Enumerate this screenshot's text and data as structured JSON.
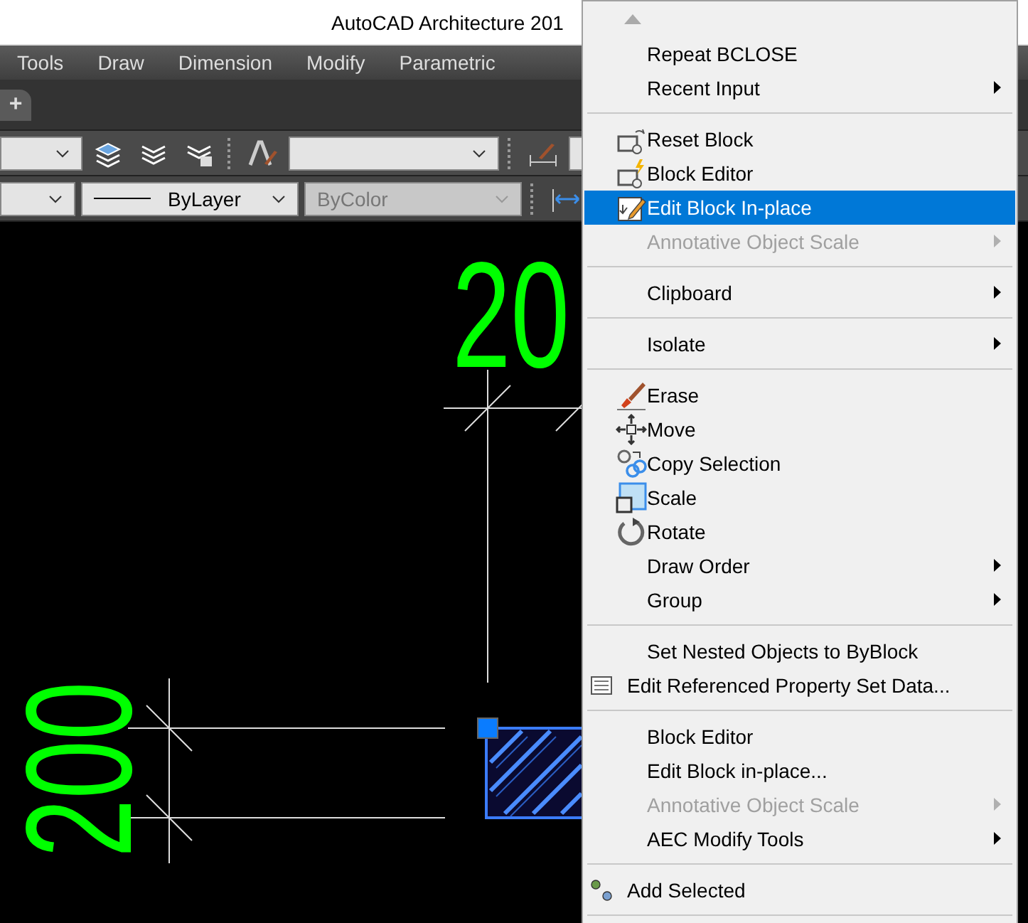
{
  "title_bar": {
    "title": "AutoCAD Architecture 201"
  },
  "menu_bar": [
    "Tools",
    "Draw",
    "Dimension",
    "Modify",
    "Parametric"
  ],
  "file_tabs": {
    "new_tab": "+"
  },
  "properties_toolbar": {
    "linetype": {
      "value": "ByLayer",
      "disabled": false
    },
    "plot_style": {
      "value": "ByColor",
      "disabled": true
    }
  },
  "drawing": {
    "top_dimension": "20",
    "left_dimension": "200"
  },
  "context_menu": {
    "items": [
      {
        "kind": "scroll-up"
      },
      {
        "kind": "plain",
        "label": "Repeat BCLOSE",
        "disabled": false,
        "selected": false,
        "submenu": false
      },
      {
        "kind": "plain",
        "label": "Recent Input",
        "disabled": false,
        "selected": false,
        "submenu": true
      },
      {
        "kind": "separator"
      },
      {
        "kind": "icon",
        "label": "Reset Block",
        "disabled": false,
        "selected": false,
        "submenu": false
      },
      {
        "kind": "icon",
        "label": "Block Editor",
        "disabled": false,
        "selected": false,
        "submenu": false
      },
      {
        "kind": "icon",
        "label": "Edit Block In-place",
        "disabled": false,
        "selected": true,
        "submenu": false
      },
      {
        "kind": "plain",
        "label": "Annotative Object Scale",
        "disabled": true,
        "selected": false,
        "submenu": true
      },
      {
        "kind": "separator"
      },
      {
        "kind": "plain",
        "label": "Clipboard",
        "disabled": false,
        "selected": false,
        "submenu": true
      },
      {
        "kind": "separator"
      },
      {
        "kind": "plain",
        "label": "Isolate",
        "disabled": false,
        "selected": false,
        "submenu": true
      },
      {
        "kind": "separator"
      },
      {
        "kind": "icon",
        "label": "Erase",
        "disabled": false,
        "selected": false,
        "submenu": false
      },
      {
        "kind": "icon",
        "label": "Move",
        "disabled": false,
        "selected": false,
        "submenu": false
      },
      {
        "kind": "icon",
        "label": "Copy Selection",
        "disabled": false,
        "selected": false,
        "submenu": false
      },
      {
        "kind": "icon",
        "label": "Scale",
        "disabled": false,
        "selected": false,
        "submenu": false
      },
      {
        "kind": "icon",
        "label": "Rotate",
        "disabled": false,
        "selected": false,
        "submenu": false
      },
      {
        "kind": "plain",
        "label": "Draw Order",
        "disabled": false,
        "selected": false,
        "submenu": true
      },
      {
        "kind": "plain",
        "label": "Group",
        "disabled": false,
        "selected": false,
        "submenu": true
      },
      {
        "kind": "separator"
      },
      {
        "kind": "plain",
        "label": "Set Nested Objects to ByBlock",
        "disabled": false,
        "selected": false,
        "submenu": false
      },
      {
        "kind": "small-icon",
        "label": "Edit Referenced Property Set Data...",
        "disabled": false,
        "selected": false,
        "submenu": false
      },
      {
        "kind": "separator"
      },
      {
        "kind": "plain",
        "label": "Block Editor",
        "disabled": false,
        "selected": false,
        "submenu": false
      },
      {
        "kind": "plain",
        "label": "Edit Block in-place...",
        "disabled": false,
        "selected": false,
        "submenu": false
      },
      {
        "kind": "plain",
        "label": "Annotative Object Scale",
        "disabled": true,
        "selected": false,
        "submenu": true
      },
      {
        "kind": "plain",
        "label": "AEC Modify Tools",
        "disabled": false,
        "selected": false,
        "submenu": true
      },
      {
        "kind": "separator"
      },
      {
        "kind": "small-icon",
        "label": "Add Selected",
        "disabled": false,
        "selected": false,
        "submenu": false
      },
      {
        "kind": "separator"
      }
    ]
  }
}
